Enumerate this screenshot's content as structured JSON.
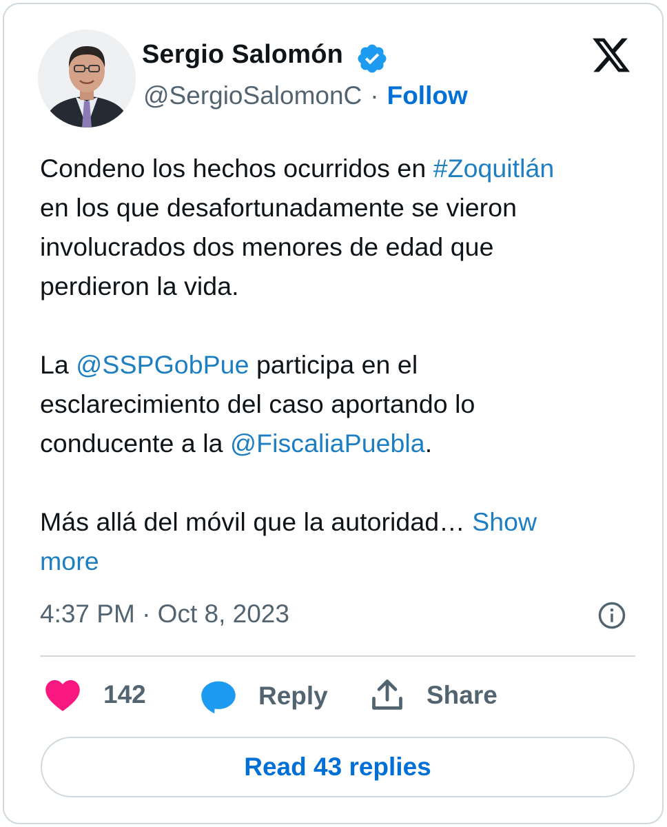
{
  "author": {
    "name": "Sergio Salomón",
    "handle": "@SergioSalomonC",
    "separator": "·",
    "follow_label": "Follow",
    "avatar": "profile-photo",
    "verified_icon": "verified-badge-icon"
  },
  "brand": {
    "logo": "x-logo",
    "color": "#0f1419"
  },
  "tweet": {
    "lines": [
      {
        "before": "Condeno los hechos ocurridos en ",
        "link": "#Zoquitlán",
        "after": ""
      },
      {
        "before": "en los que desafortunadamente se vieron",
        "link": "",
        "after": ""
      },
      {
        "before": "involucrados dos menores de edad que",
        "link": "",
        "after": ""
      },
      {
        "before": "perdieron la vida.",
        "link": "",
        "after": ""
      },
      {
        "before": "La ",
        "link": "@SSPGobPue",
        "after": " participa en el"
      },
      {
        "before": "esclarecimiento del caso aportando lo",
        "link": "",
        "after": ""
      },
      {
        "before": "conducente a la ",
        "link": "@FiscaliaPuebla",
        "after": "."
      },
      {
        "before": "Más allá del móvil que la autoridad… ",
        "link": "Show",
        "after": ""
      },
      {
        "before": "",
        "link": "more",
        "after": ""
      }
    ]
  },
  "timestamp": "4:37 PM · Oct 8, 2023",
  "actions": {
    "like_count": "142",
    "reply_label": "Reply",
    "share_label": "Share"
  },
  "read_replies_label": "Read 43 replies",
  "colors": {
    "link": "#1d7ec2",
    "accent": "#006fd6",
    "like": "#f91880",
    "reply_icon": "#1d9bf0",
    "verified": "#1d9bf0",
    "muted": "#536471",
    "border": "#cfd9de"
  }
}
